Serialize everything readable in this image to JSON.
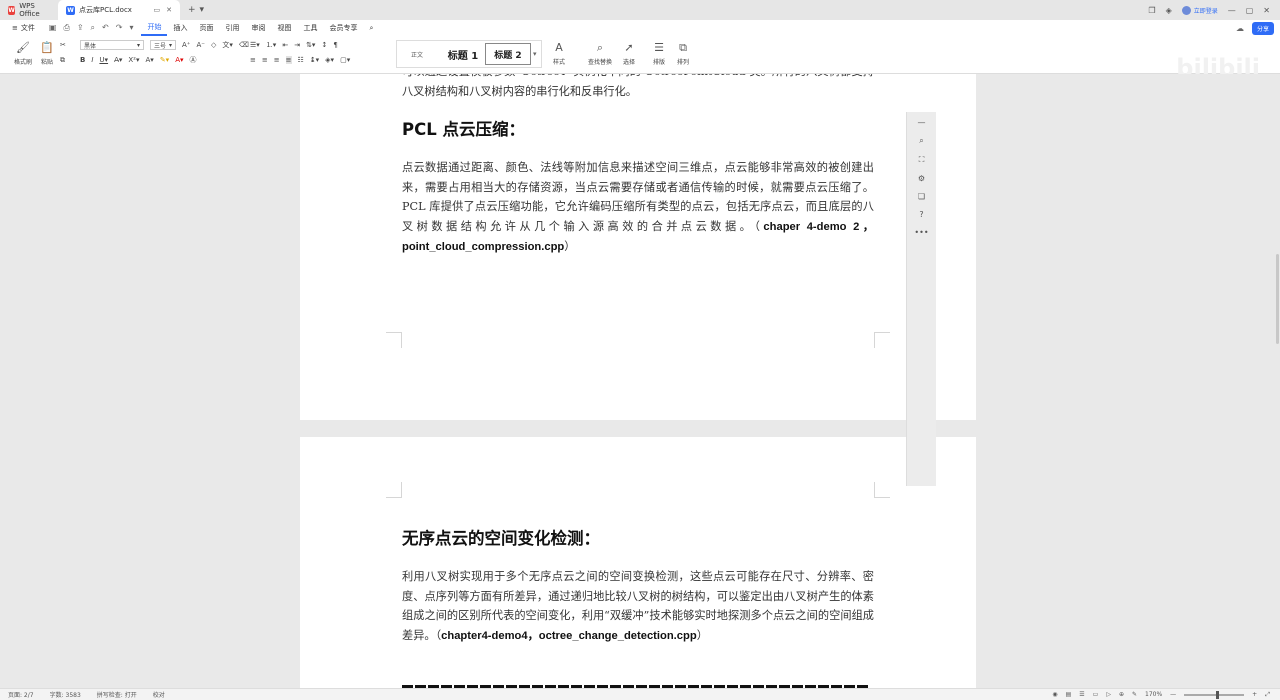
{
  "tabs": {
    "app_name": "WPS Office",
    "doc_name": "点云库PCL.docx"
  },
  "login_label": "立即登录",
  "menu": {
    "file": "文件",
    "items": [
      "开始",
      "插入",
      "页面",
      "引用",
      "审阅",
      "视图",
      "工具",
      "会员专享"
    ],
    "share": "分享"
  },
  "ribbon": {
    "format_painter": "格式刷",
    "paste": "粘贴",
    "font_name": "黑体",
    "font_size": "三号",
    "style_normal": "正文",
    "style_h1": "标题 1",
    "style_h2": "标题 2",
    "styles": "样式",
    "find_replace": "查找替换",
    "select": "选择",
    "layout": "排版",
    "arrange": "排列",
    "watermark": "bilibili"
  },
  "doc": {
    "p0": "可以通过设置模板参数“OctreeT”实例化不同的 OctreePointCloud 类。所有的八叉树都支持八叉树结构和八叉树内容的串行化和反串行化。",
    "h1": "PCL 点云压缩：",
    "p1_text": "点云数据通过距离、颜色、法线等附加信息来描述空间三维点，点云能够非常高效的被创建出来，需要占用相当大的存储资源，当点云需要存储或者通信传输的时候，就需要点云压缩了。PCL 库提供了点云压缩功能，它允许编码压缩所有类型的点云，包括无序点云，而且底层的八叉树数据结构允许从几个输入源高效的合并点云数据。（",
    "p1_bold": "chaper 4-demo 2，point_cloud_compression.cpp",
    "p1_end": "）",
    "h2": "无序点云的空间变化检测：",
    "p2_text": "利用八叉树实现用于多个无序点云之间的空间变换检测，这些点云可能存在尺寸、分辨率、密度、点序列等方面有所差异，通过递归地比较八叉树的树结构，可以鉴定出由八叉树产生的体素组成之间的区别所代表的空间变化，利用“双缓冲”技术能够实时地探测多个点云之间的空间组成差异。（",
    "p2_bold": "chapter4-demo4，octree_change_detection.cpp",
    "p2_end": "）"
  },
  "status": {
    "page": "页面: 2/7",
    "words": "字数: 3583",
    "spell": "拼写检查: 打开",
    "proof": "校对",
    "zoom": "170%"
  },
  "colors": {
    "accent": "#2f6cf6",
    "wps_red": "#e9413d"
  }
}
